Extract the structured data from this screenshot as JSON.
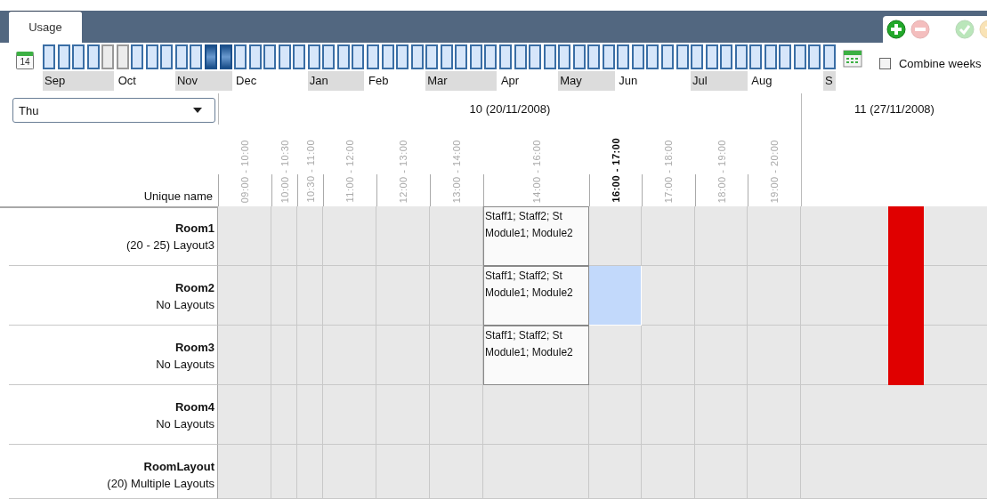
{
  "tabs": [
    {
      "label": "Usage",
      "selected": true
    }
  ],
  "toolbar": [
    {
      "kind": "add",
      "disabled": false
    },
    {
      "kind": "remove",
      "disabled": true
    },
    {
      "kind": "separator"
    },
    {
      "kind": "accept",
      "disabled": true
    },
    {
      "kind": "undo",
      "disabled": true
    }
  ],
  "calendar_day": "14",
  "weeks": [
    {
      "selected": false,
      "disabled": false
    },
    {
      "selected": false,
      "disabled": false
    },
    {
      "selected": false,
      "disabled": false
    },
    {
      "selected": false,
      "disabled": false
    },
    {
      "selected": false,
      "disabled": true
    },
    {
      "selected": false,
      "disabled": true
    },
    {
      "selected": false,
      "disabled": false
    },
    {
      "selected": false,
      "disabled": false
    },
    {
      "selected": false,
      "disabled": false
    },
    {
      "selected": false,
      "disabled": false
    },
    {
      "selected": false,
      "disabled": false
    },
    {
      "selected": true,
      "disabled": false
    },
    {
      "selected": true,
      "disabled": false
    },
    {
      "selected": false,
      "disabled": false
    },
    {
      "selected": false,
      "disabled": false
    },
    {
      "selected": false,
      "disabled": false
    },
    {
      "selected": false,
      "disabled": false
    },
    {
      "selected": false,
      "disabled": false
    },
    {
      "selected": false,
      "disabled": false
    },
    {
      "selected": false,
      "disabled": false
    },
    {
      "selected": false,
      "disabled": false
    },
    {
      "selected": false,
      "disabled": false
    },
    {
      "selected": false,
      "disabled": false
    },
    {
      "selected": false,
      "disabled": false
    },
    {
      "selected": false,
      "disabled": false
    },
    {
      "selected": false,
      "disabled": false
    },
    {
      "selected": false,
      "disabled": false
    },
    {
      "selected": false,
      "disabled": false
    },
    {
      "selected": false,
      "disabled": false
    },
    {
      "selected": false,
      "disabled": false
    },
    {
      "selected": false,
      "disabled": false
    },
    {
      "selected": false,
      "disabled": false
    },
    {
      "selected": false,
      "disabled": false
    },
    {
      "selected": false,
      "disabled": false
    },
    {
      "selected": false,
      "disabled": false
    },
    {
      "selected": false,
      "disabled": false
    },
    {
      "selected": false,
      "disabled": false
    },
    {
      "selected": false,
      "disabled": false
    },
    {
      "selected": false,
      "disabled": false
    },
    {
      "selected": false,
      "disabled": false
    },
    {
      "selected": false,
      "disabled": false
    },
    {
      "selected": false,
      "disabled": false
    },
    {
      "selected": false,
      "disabled": false
    },
    {
      "selected": false,
      "disabled": false
    },
    {
      "selected": false,
      "disabled": false
    },
    {
      "selected": false,
      "disabled": false
    },
    {
      "selected": false,
      "disabled": false
    },
    {
      "selected": false,
      "disabled": false
    },
    {
      "selected": false,
      "disabled": false
    },
    {
      "selected": false,
      "disabled": false
    },
    {
      "selected": false,
      "disabled": false
    },
    {
      "selected": false,
      "disabled": false
    },
    {
      "selected": false,
      "disabled": false
    },
    {
      "selected": false,
      "disabled": false
    }
  ],
  "months": [
    "Sep",
    "Oct",
    "Nov",
    "Dec",
    "Jan",
    "Feb",
    "Mar",
    "Apr",
    "May",
    "Jun",
    "Jul",
    "Aug",
    "S"
  ],
  "combine_weeks": {
    "label": "Combine weeks",
    "checked": false
  },
  "day_filter": {
    "value": "Thu"
  },
  "row_header_label": "Unique name",
  "week_headers": [
    "10 (20/11/2008)",
    "11 (27/11/2008)"
  ],
  "time_columns": [
    {
      "label": "09:00 - 10:00",
      "selected": false
    },
    {
      "label": "10:00 - 10:30",
      "selected": false
    },
    {
      "label": "10:30 - 11:00",
      "selected": false
    },
    {
      "label": "11:00 - 12:00",
      "selected": false
    },
    {
      "label": "12:00 - 13:00",
      "selected": false
    },
    {
      "label": "13:00 - 14:00",
      "selected": false
    },
    {
      "label": "14:00 - 16:00",
      "selected": false
    },
    {
      "label": "16:00 - 17:00",
      "selected": true
    },
    {
      "label": "17:00 - 18:00",
      "selected": false
    },
    {
      "label": "18:00 - 19:00",
      "selected": false
    },
    {
      "label": "19:00 - 20:00",
      "selected": false
    }
  ],
  "rows": [
    {
      "name": "Room1",
      "detail": "(20 - 25) Layout3",
      "week_11_booked": true,
      "cells": [
        {
          "kind": "empty",
          "selected": false
        },
        {
          "kind": "empty",
          "selected": false
        },
        {
          "kind": "empty",
          "selected": false
        },
        {
          "kind": "empty",
          "selected": false
        },
        {
          "kind": "empty",
          "selected": false
        },
        {
          "kind": "empty",
          "selected": false
        },
        {
          "kind": "booking",
          "selected": false,
          "lines": [
            "Staff1; Staff2; St",
            "Module1; Module2"
          ]
        },
        {
          "kind": "empty",
          "selected": false
        },
        {
          "kind": "empty",
          "selected": false
        },
        {
          "kind": "empty",
          "selected": false
        },
        {
          "kind": "empty",
          "selected": false
        }
      ]
    },
    {
      "name": "Room2",
      "detail": "No Layouts",
      "week_11_booked": true,
      "cells": [
        {
          "kind": "empty",
          "selected": false
        },
        {
          "kind": "empty",
          "selected": false
        },
        {
          "kind": "empty",
          "selected": false
        },
        {
          "kind": "empty",
          "selected": false
        },
        {
          "kind": "empty",
          "selected": false
        },
        {
          "kind": "empty",
          "selected": false
        },
        {
          "kind": "booking",
          "selected": false,
          "lines": [
            "Staff1; Staff2; St",
            "Module1; Module2"
          ]
        },
        {
          "kind": "empty",
          "selected": true
        },
        {
          "kind": "empty",
          "selected": false
        },
        {
          "kind": "empty",
          "selected": false
        },
        {
          "kind": "empty",
          "selected": false
        }
      ]
    },
    {
      "name": "Room3",
      "detail": "No Layouts",
      "week_11_booked": true,
      "cells": [
        {
          "kind": "empty",
          "selected": false
        },
        {
          "kind": "empty",
          "selected": false
        },
        {
          "kind": "empty",
          "selected": false
        },
        {
          "kind": "empty",
          "selected": false
        },
        {
          "kind": "empty",
          "selected": false
        },
        {
          "kind": "empty",
          "selected": false
        },
        {
          "kind": "booking",
          "selected": false,
          "lines": [
            "Staff1; Staff2; St",
            "Module1; Module2"
          ]
        },
        {
          "kind": "empty",
          "selected": false
        },
        {
          "kind": "empty",
          "selected": false
        },
        {
          "kind": "empty",
          "selected": false
        },
        {
          "kind": "empty",
          "selected": false
        }
      ]
    },
    {
      "name": "Room4",
      "detail": "No Layouts",
      "week_11_booked": false,
      "cells": [
        {
          "kind": "empty",
          "selected": false
        },
        {
          "kind": "empty",
          "selected": false
        },
        {
          "kind": "empty",
          "selected": false
        },
        {
          "kind": "empty",
          "selected": false
        },
        {
          "kind": "empty",
          "selected": false
        },
        {
          "kind": "empty",
          "selected": false
        },
        {
          "kind": "empty",
          "selected": false
        },
        {
          "kind": "empty",
          "selected": false
        },
        {
          "kind": "empty",
          "selected": false
        },
        {
          "kind": "empty",
          "selected": false
        },
        {
          "kind": "empty",
          "selected": false
        }
      ]
    },
    {
      "name": "RoomLayout",
      "detail": "(20) Multiple Layouts",
      "week_11_booked": false,
      "cells": [
        {
          "kind": "empty",
          "selected": false
        },
        {
          "kind": "empty",
          "selected": false
        },
        {
          "kind": "empty",
          "selected": false
        },
        {
          "kind": "empty",
          "selected": false
        },
        {
          "kind": "empty",
          "selected": false
        },
        {
          "kind": "empty",
          "selected": false
        },
        {
          "kind": "empty",
          "selected": false
        },
        {
          "kind": "empty",
          "selected": false
        },
        {
          "kind": "empty",
          "selected": false
        },
        {
          "kind": "empty",
          "selected": false
        },
        {
          "kind": "empty",
          "selected": false
        }
      ]
    }
  ]
}
